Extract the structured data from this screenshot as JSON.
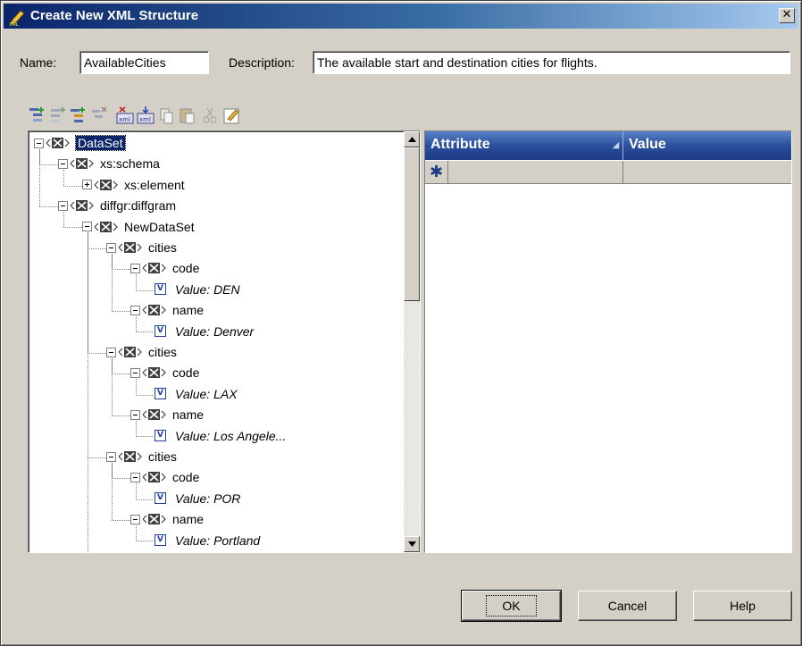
{
  "window": {
    "title": "Create New XML Structure",
    "close_glyph": "✕"
  },
  "form": {
    "name_label": "Name:",
    "name_value": "AvailableCities",
    "description_label": "Description:",
    "description_value": "The available start and destination cities for flights."
  },
  "toolbar": {
    "buttons": [
      "add-child-node-icon",
      "add-sibling-node-icon",
      "add-attribute-icon",
      "remove-node-icon",
      "import-xml-icon",
      "export-xml-icon",
      "copy-icon",
      "paste-icon",
      "cut-icon",
      "edit-icon"
    ]
  },
  "tree": {
    "nodes": [
      {
        "label": "DataSet",
        "depth": 0,
        "type": "element",
        "expander": "minus",
        "selected": true
      },
      {
        "label": "xs:schema",
        "depth": 1,
        "type": "element",
        "expander": "minus"
      },
      {
        "label": "xs:element",
        "depth": 2,
        "type": "element",
        "expander": "plus"
      },
      {
        "label": "diffgr:diffgram",
        "depth": 1,
        "type": "element",
        "expander": "minus"
      },
      {
        "label": "NewDataSet",
        "depth": 2,
        "type": "element",
        "expander": "minus"
      },
      {
        "label": "cities",
        "depth": 3,
        "type": "element",
        "expander": "minus"
      },
      {
        "label": "code",
        "depth": 4,
        "type": "element",
        "expander": "minus"
      },
      {
        "label": "Value: DEN",
        "depth": 5,
        "type": "value"
      },
      {
        "label": "name",
        "depth": 4,
        "type": "element",
        "expander": "minus"
      },
      {
        "label": "Value: Denver",
        "depth": 5,
        "type": "value"
      },
      {
        "label": "cities",
        "depth": 3,
        "type": "element",
        "expander": "minus"
      },
      {
        "label": "code",
        "depth": 4,
        "type": "element",
        "expander": "minus"
      },
      {
        "label": "Value: LAX",
        "depth": 5,
        "type": "value"
      },
      {
        "label": "name",
        "depth": 4,
        "type": "element",
        "expander": "minus"
      },
      {
        "label": "Value: Los Angele...",
        "depth": 5,
        "type": "value"
      },
      {
        "label": "cities",
        "depth": 3,
        "type": "element",
        "expander": "minus"
      },
      {
        "label": "code",
        "depth": 4,
        "type": "element",
        "expander": "minus"
      },
      {
        "label": "Value: POR",
        "depth": 5,
        "type": "value"
      },
      {
        "label": "name",
        "depth": 4,
        "type": "element",
        "expander": "minus"
      },
      {
        "label": "Value: Portland",
        "depth": 5,
        "type": "value"
      }
    ]
  },
  "grid": {
    "columns": [
      "Attribute",
      "Value"
    ],
    "new_row_marker": "✱"
  },
  "buttons": {
    "ok": "OK",
    "cancel": "Cancel",
    "help": "Help"
  }
}
